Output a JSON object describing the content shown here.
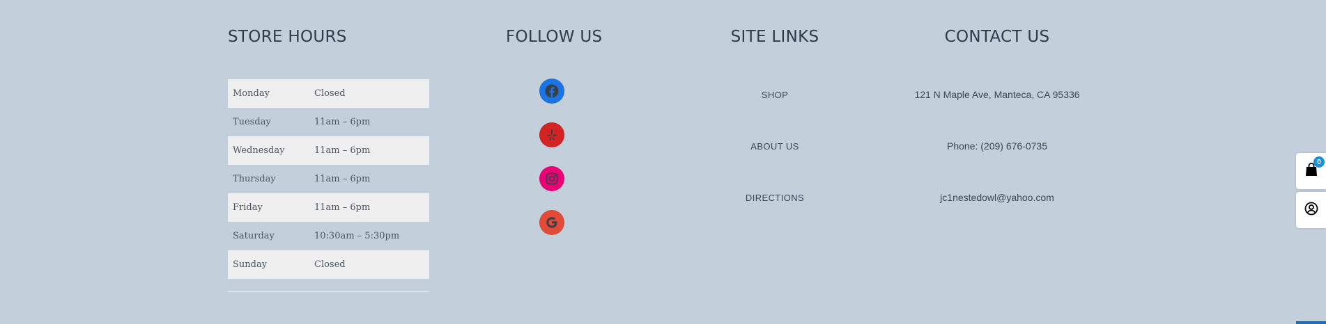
{
  "store_hours": {
    "title": "STORE HOURS",
    "rows": [
      {
        "day": "Monday",
        "hours": "Closed"
      },
      {
        "day": "Tuesday",
        "hours": "11am – 6pm"
      },
      {
        "day": "Wednesday",
        "hours": "11am – 6pm"
      },
      {
        "day": "Thursday",
        "hours": "11am – 6pm"
      },
      {
        "day": "Friday",
        "hours": "11am – 6pm"
      },
      {
        "day": "Saturday",
        "hours": "10:30am – 5:30pm"
      },
      {
        "day": "Sunday",
        "hours": "Closed"
      }
    ]
  },
  "follow_us": {
    "title": "FOLLOW US",
    "icons": [
      {
        "name": "facebook-icon",
        "color": "#1b74e4"
      },
      {
        "name": "yelp-icon",
        "color": "#d32323"
      },
      {
        "name": "instagram-icon",
        "color": "#ec0075"
      },
      {
        "name": "google-icon",
        "color": "#e14b37"
      }
    ]
  },
  "site_links": {
    "title": "SITE LINKS",
    "items": [
      "SHOP",
      "ABOUT US",
      "DIRECTIONS"
    ]
  },
  "contact_us": {
    "title": "CONTACT US",
    "address": "121 N Maple Ave, Manteca, CA 95336",
    "phone": "Phone: (209) 676-0735",
    "email": "jc1nestedowl@yahoo.com"
  },
  "side_widgets": {
    "cart_count": "0",
    "cart_icon": "shopping-bag-icon",
    "account_icon": "user-circle-icon",
    "badge_color": "#1c8fd6"
  }
}
